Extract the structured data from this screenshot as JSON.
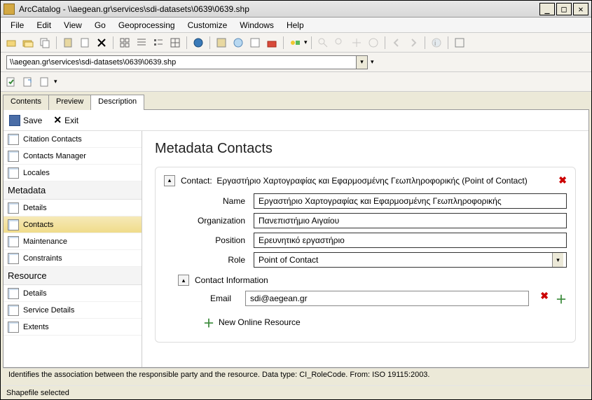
{
  "titlebar": {
    "app": "ArcCatalog",
    "path": "\\\\aegean.gr\\services\\sdi-datasets\\0639\\0639.shp"
  },
  "menubar": [
    "File",
    "Edit",
    "View",
    "Go",
    "Geoprocessing",
    "Customize",
    "Windows",
    "Help"
  ],
  "path_input": "\\\\aegean.gr\\services\\sdi-datasets\\0639\\0639.shp",
  "tabs": [
    "Contents",
    "Preview",
    "Description"
  ],
  "active_tab": "Description",
  "actions": {
    "save": "Save",
    "exit": "Exit"
  },
  "nav": {
    "items_top": [
      "Citation Contacts",
      "Contacts Manager",
      "Locales"
    ],
    "h1": "Metadata",
    "items_meta": [
      "Details",
      "Contacts",
      "Maintenance",
      "Constraints"
    ],
    "h2": "Resource",
    "items_res": [
      "Details",
      "Service Details",
      "Extents"
    ],
    "selected": "Contacts"
  },
  "form": {
    "heading": "Metadata Contacts",
    "contact_label": "Contact:",
    "contact_title": "Εργαστήριο Χαρτογραφίας και Εφαρμοσμένης Γεωπληροφορικής (Point of Contact)",
    "name_label": "Name",
    "name_value": "Εργαστήριο Χαρτογραφίας και Εφαρμοσμένης Γεωπληροφορικής",
    "org_label": "Organization",
    "org_value": "Πανεπιστήμιο Αιγαίου",
    "pos_label": "Position",
    "pos_value": "Ερευνητικό εργαστήριο",
    "role_label": "Role",
    "role_value": "Point of Contact",
    "contact_info": "Contact Information",
    "email_label": "Email",
    "email_value": "sdi@aegean.gr",
    "new_online": "New Online Resource"
  },
  "help_text": "Identifies the association between the responsible party and the resource. Data type: CI_RoleCode. From: ISO 19115:2003.",
  "status": "Shapefile selected"
}
